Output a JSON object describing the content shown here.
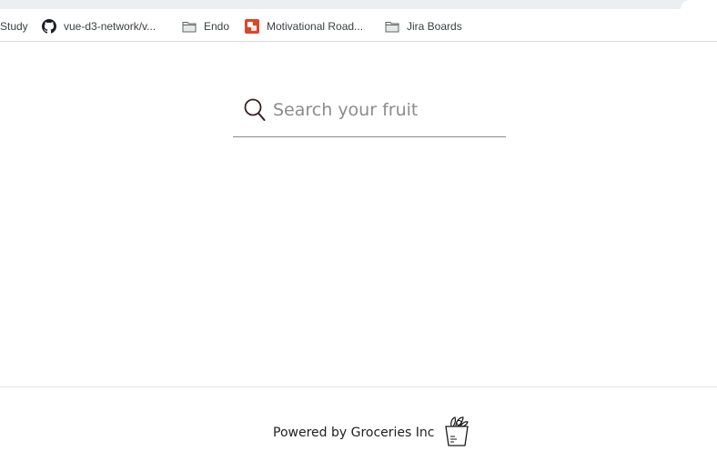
{
  "bookmarks": [
    {
      "label": "Study",
      "icon": "none"
    },
    {
      "label": "vue-d3-network/v...",
      "icon": "github-icon"
    },
    {
      "label": "Endo",
      "icon": "folder-icon"
    },
    {
      "label": "Motivational Road...",
      "icon": "app-icon"
    },
    {
      "label": "Jira Boards",
      "icon": "folder-icon"
    }
  ],
  "search": {
    "placeholder": "Search your fruit",
    "value": ""
  },
  "footer": {
    "text": "Powered by Groceries Inc",
    "logo": "grocery-bag-icon"
  },
  "colors": {
    "bookmark_text": "#3c4043",
    "app_icon": "#d9472b",
    "search_icon": "#3a1f1f"
  }
}
